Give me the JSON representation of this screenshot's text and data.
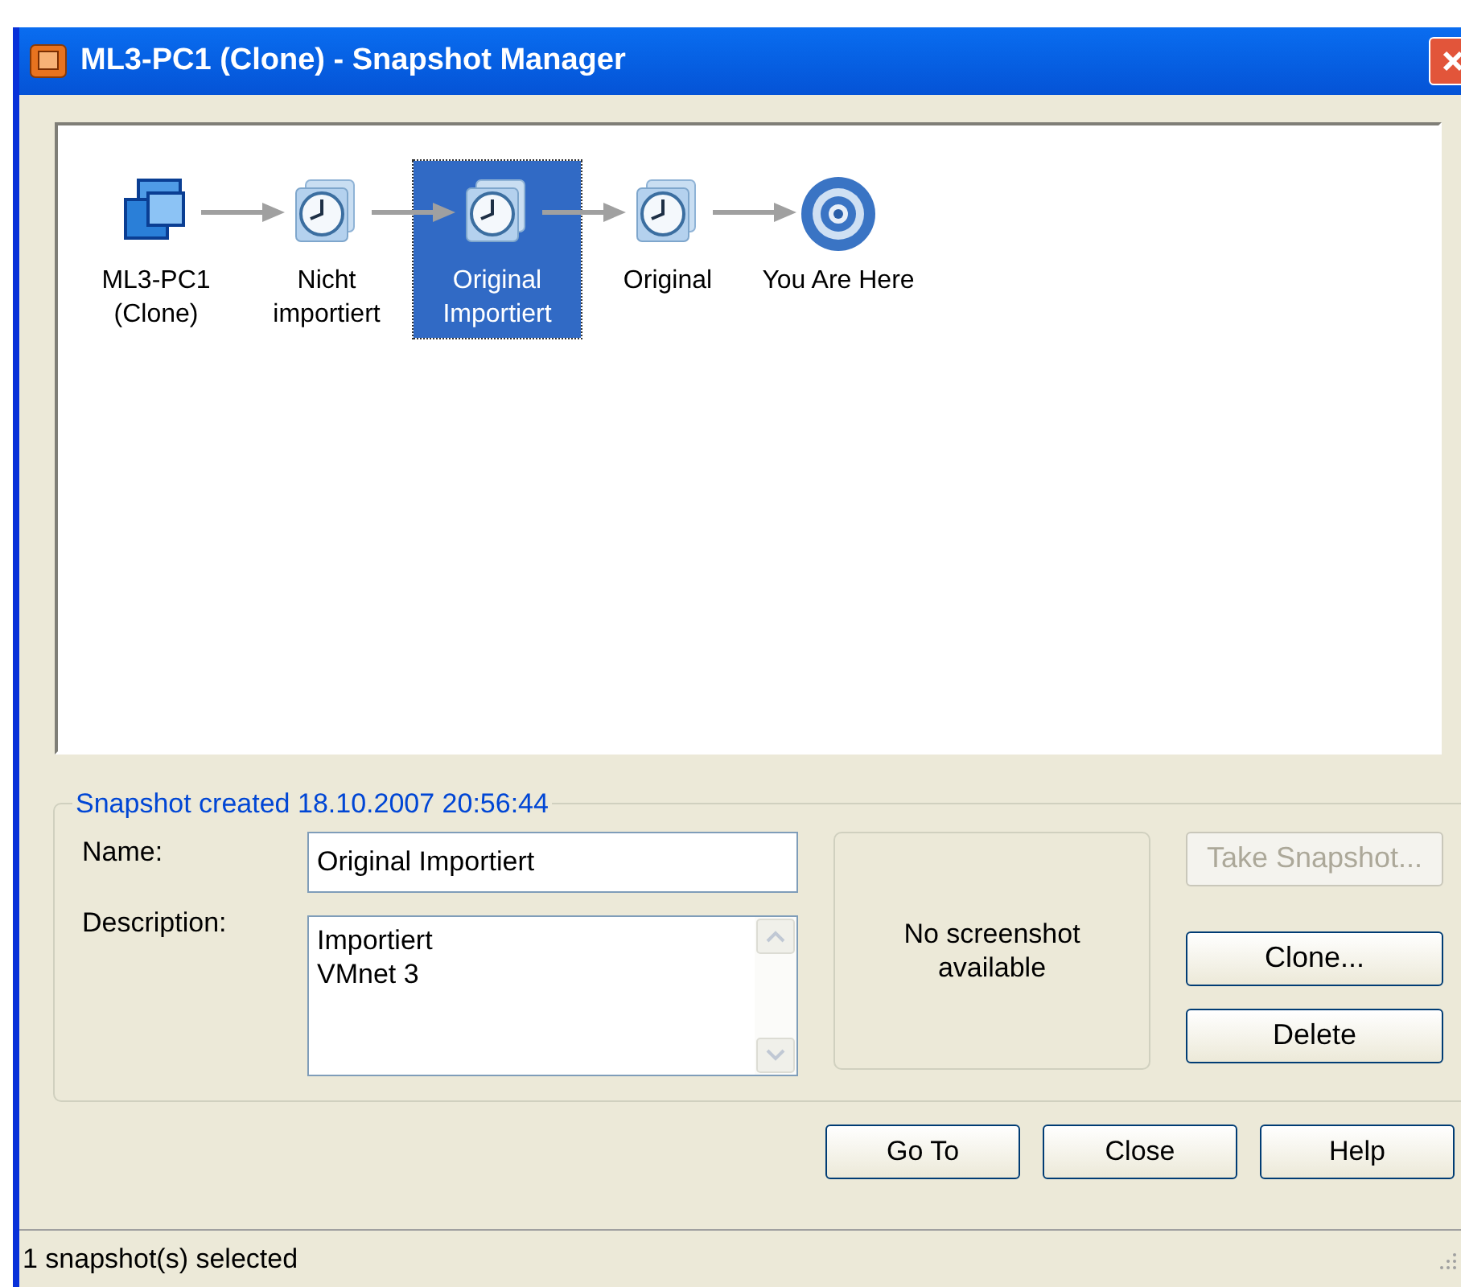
{
  "window": {
    "title": "ML3-PC1 (Clone) - Snapshot Manager"
  },
  "nodes": [
    {
      "kind": "vm",
      "label": "ML3-PC1 (Clone)",
      "selected": false
    },
    {
      "kind": "snapshot",
      "label": "Nicht importiert",
      "selected": false
    },
    {
      "kind": "snapshot",
      "label": "Original Importiert",
      "selected": true
    },
    {
      "kind": "snapshot",
      "label": "Original",
      "selected": false
    },
    {
      "kind": "current",
      "label": "You Are Here",
      "selected": false
    }
  ],
  "details": {
    "legend": "Snapshot created 18.10.2007 20:56:44",
    "name_label": "Name:",
    "name_value": "Original Importiert",
    "description_label": "Description:",
    "description_value": "Importiert\nVMnet 3",
    "screenshot_text": "No screenshot available"
  },
  "side_buttons": [
    {
      "label": "Take Snapshot...",
      "disabled": true
    },
    {
      "label": "Clone...",
      "disabled": false
    },
    {
      "label": "Delete",
      "disabled": false
    }
  ],
  "buttons": [
    {
      "label": "Go To"
    },
    {
      "label": "Close"
    },
    {
      "label": "Help"
    }
  ],
  "status_bar": "1 snapshot(s) selected"
}
